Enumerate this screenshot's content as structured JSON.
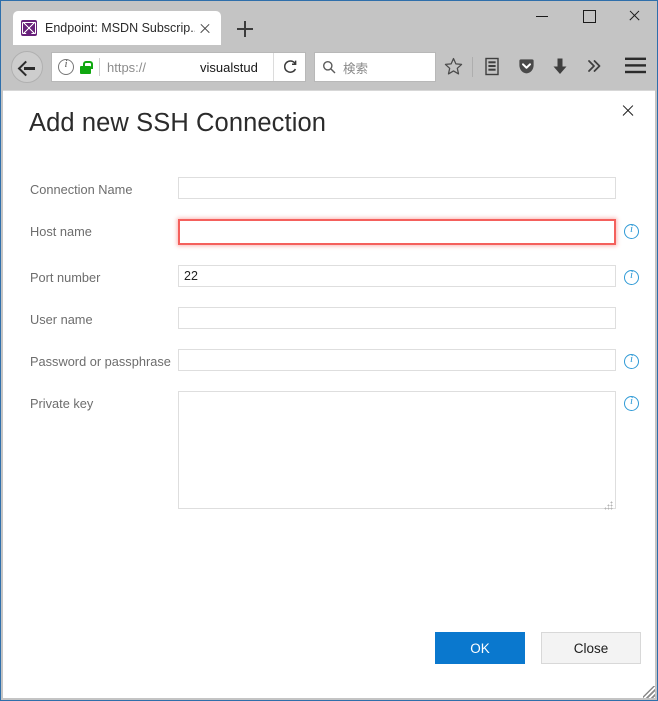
{
  "browser": {
    "tab": {
      "title": "Endpoint: MSDN Subscrip...",
      "favicon": "visual-studio-icon",
      "close_label": "close-tab"
    },
    "new_tab_label": "+",
    "window_controls": {
      "minimize": "minimize",
      "maximize": "maximize",
      "close": "close"
    },
    "toolbar": {
      "back_label": "Back",
      "identity_icon": "info-circle-icon",
      "security_icon": "lock-icon",
      "url_scheme": "https://",
      "url_host": "visualstud",
      "reload_label": "Reload",
      "search_placeholder": "検索",
      "search_icon": "search-icon",
      "bookmark_icon": "star-icon",
      "library_icon": "library-icon",
      "pocket_icon": "pocket-icon",
      "downloads_icon": "download-arrow-icon",
      "overflow_icon": "chevron-double-right-icon",
      "menu_icon": "hamburger-menu-icon"
    }
  },
  "dialog": {
    "title": "Add new SSH Connection",
    "close_label": "close-dialog",
    "fields": [
      {
        "label": "Connection Name",
        "value": "",
        "type": "text",
        "has_info": false,
        "error": false,
        "name": "connection-name"
      },
      {
        "label": "Host name",
        "value": "",
        "type": "text",
        "has_info": true,
        "error": true,
        "name": "host-name"
      },
      {
        "label": "Port number",
        "value": "22",
        "type": "text",
        "has_info": true,
        "error": false,
        "name": "port-number"
      },
      {
        "label": "User name",
        "value": "",
        "type": "text",
        "has_info": false,
        "error": false,
        "name": "user-name"
      },
      {
        "label": "Password or passphrase",
        "value": "",
        "type": "text",
        "has_info": true,
        "error": false,
        "name": "password-or-passphrase"
      },
      {
        "label": "Private key",
        "value": "",
        "type": "textarea",
        "has_info": true,
        "error": false,
        "name": "private-key"
      }
    ],
    "buttons": {
      "ok_label": "OK",
      "close_label": "Close"
    }
  },
  "colors": {
    "accent": "#0a78ce",
    "error": "#f4605c",
    "info": "#2f9ad6",
    "chrome": "#c4c4c4",
    "window_border": "#2f6fab"
  }
}
